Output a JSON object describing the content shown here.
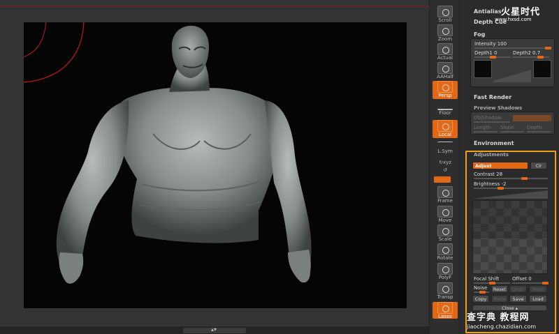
{
  "shelf": {
    "tools": [
      {
        "name": "scroll",
        "label": "Scroll"
      },
      {
        "name": "zoom",
        "label": "Zoom"
      },
      {
        "name": "actual",
        "label": "Actual"
      },
      {
        "name": "aahalf",
        "label": "AAHalf"
      },
      {
        "name": "persp",
        "label": "Persp"
      },
      {
        "name": "floor",
        "label": "Floor"
      },
      {
        "name": "local",
        "label": "Local"
      },
      {
        "name": "lsym",
        "label": "L.Sym"
      },
      {
        "name": "frame",
        "label": "Frame"
      },
      {
        "name": "move",
        "label": "Move"
      },
      {
        "name": "scale",
        "label": "Scale"
      },
      {
        "name": "rotate",
        "label": "Rotate"
      },
      {
        "name": "polyf",
        "label": "PolyF"
      },
      {
        "name": "transp",
        "label": "Transp"
      },
      {
        "name": "lasso",
        "label": "Lasso"
      }
    ],
    "xyz_label": "xyz"
  },
  "panel": {
    "antialias_label": "Antialias",
    "depth_cue_label": "Depth Cue",
    "fog": {
      "title": "Fog",
      "intensity_label": "Intensity",
      "intensity_value": "100",
      "intensity_fraction": 1.0,
      "depth1_label": "Depth1",
      "depth1_value": "0",
      "depth2_label": "Depth2",
      "depth2_value": "0.7"
    },
    "fast_render_label": "Fast Render",
    "preview_shadows": {
      "title": "Preview Shadows",
      "obj_shadow_label": "ObjShadow",
      "length_label": "Length",
      "slope_label": "Slope",
      "depth_label": "Depth"
    },
    "environment_label": "Environment",
    "adjustments": {
      "title": "Adjustments",
      "adjust_button": "Adjust",
      "clr_button": "Clr",
      "contrast_label": "Contrast",
      "contrast_value": "28",
      "brightness_label": "Brightness",
      "brightness_value": "-2",
      "focal_shift_label": "Focal Shift",
      "offset_label": "Offset",
      "offset_value": "0",
      "noise_label": "Noise",
      "reset_button": "Reset",
      "undo_button": "Undo",
      "redo_button": "Redo",
      "copy_button": "Copy",
      "paste_button": "Paste",
      "save_button": "Save",
      "load_button": "Load",
      "close_button": "Close ▴"
    }
  },
  "watermarks": {
    "top": "火星时代",
    "top_url": "www.hxsd.com",
    "bottom": "查字典 教程网",
    "bottom_url": "jiaocheng.chazidian.com"
  },
  "colors": {
    "accent": "#e26818",
    "highlight_frame": "#f0a020",
    "panel_bg": "#2b2b2b",
    "canvas_bg": "#050505"
  }
}
